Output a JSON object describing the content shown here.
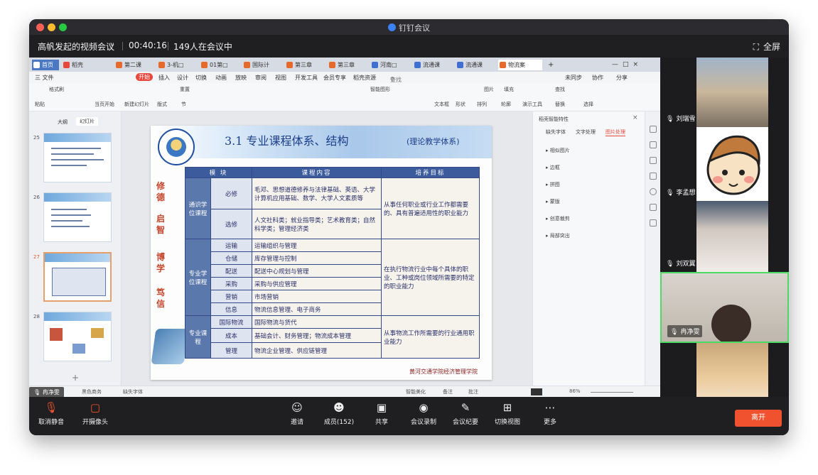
{
  "window": {
    "app_title": "钉钉会议",
    "meeting_name": "高帆发起的视频会议",
    "elapsed": "00:40:16",
    "participants_text": "149人在会议中",
    "fullscreen_label": "全屏"
  },
  "wps": {
    "tabs": [
      "首页",
      "稻壳",
      "第二课",
      "3-机□",
      "01第□",
      "国际计",
      "第三章",
      "第三章",
      "河南□",
      "流通课",
      "流通课",
      "物流案"
    ],
    "menu": [
      "三 文件",
      "开始",
      "插入",
      "设计",
      "切换",
      "动画",
      "放映",
      "审阅",
      "视图",
      "开发工具",
      "会员专享",
      "稻壳资源",
      "查找命令、搜索模板",
      "未同步",
      "协作",
      "分享"
    ],
    "ribbon_labels": [
      "格式刷",
      "粘贴",
      "当页开始",
      "新建幻灯片",
      "版式",
      "节",
      "重置",
      "文本框",
      "形状",
      "排列",
      "演示工具",
      "查找",
      "替换",
      "选择",
      "图片",
      "填充",
      "轮廓",
      "智能图形"
    ],
    "left_tabs": [
      "大纲",
      "幻灯片"
    ],
    "slide_numbers": [
      "25",
      "26",
      "27",
      "28"
    ],
    "status_note": "缺失字体",
    "status_theme": "黑色商务",
    "status_beautify": "智能美化",
    "status_notes": "备注",
    "status_comment": "批注",
    "zoom": "86%",
    "right_tabs": [
      "缺失字体",
      "文字处理",
      "图片处理"
    ],
    "right_header": "稻壳智能特性",
    "right_items": [
      "相似图片",
      "边框",
      "拼图",
      "蒙版",
      "创意裁剪",
      "局部突出"
    ]
  },
  "slide": {
    "title": "3.1 专业课程体系、结构",
    "subtitle": "(理论教学体系)",
    "motto": [
      "修",
      "德",
      "启",
      "智",
      "博",
      "学",
      "笃",
      "信"
    ],
    "headers": [
      "模 块",
      "课程内容",
      "培养目标"
    ],
    "groups": [
      {
        "name": "通识学位课程",
        "goal": "从事任何职业或行业工作都需要的、具有普遍适用性的职业能力",
        "rows": [
          {
            "sub": "必修",
            "content": "毛邓、思想道德修养与法律基础、英语、大学计算机应用基础、数学、大学人文素质等"
          },
          {
            "sub": "选修",
            "content": "人文社科类；就业指导类；艺术教育类；自然科学类；管理经济类"
          }
        ]
      },
      {
        "name": "专业学位课程",
        "goal": "在执行物流行业中每个具体的职业、工种或岗位领域所需要的特定的职业能力",
        "rows": [
          {
            "sub": "运输",
            "content": "运输组织与管理"
          },
          {
            "sub": "仓储",
            "content": "库存管理与控制"
          },
          {
            "sub": "配送",
            "content": "配送中心规划与管理"
          },
          {
            "sub": "采购",
            "content": "采购与供应管理"
          },
          {
            "sub": "营销",
            "content": "市场营销"
          },
          {
            "sub": "信息",
            "content": "物流信息管理、电子商务"
          }
        ]
      },
      {
        "name": "专业课程",
        "goal": "从事物流工作所需要的行业通用职业能力",
        "rows": [
          {
            "sub": "国际物流",
            "content": "国际物流与货代"
          },
          {
            "sub": "成本",
            "content": "基础会计、财务管理；物流成本管理"
          },
          {
            "sub": "管理",
            "content": "物流企业管理、供应链管理"
          }
        ]
      }
    ],
    "footer": "黄河交通学院经济管理学院"
  },
  "participants": [
    {
      "name": "刘瑞雪",
      "mic": "muted"
    },
    {
      "name": "李孟想",
      "mic": "muted"
    },
    {
      "name": "刘双翼",
      "mic": "muted"
    },
    {
      "name": "冉净雯",
      "mic": "on"
    },
    {
      "name": "",
      "mic": "muted"
    }
  ],
  "self_name": "冉净雯",
  "toolbar": {
    "unmute": "取消静音",
    "camera": "开摄像头",
    "invite": "邀请",
    "members": "成员(152)",
    "share": "共享",
    "record": "会议录制",
    "minutes": "会议纪要",
    "switch_view": "切换视图",
    "more": "更多",
    "leave": "离开"
  },
  "colors": {
    "leave": "#f0522f",
    "accent": "#3b82f6",
    "slide_title": "#1d3f8a"
  }
}
